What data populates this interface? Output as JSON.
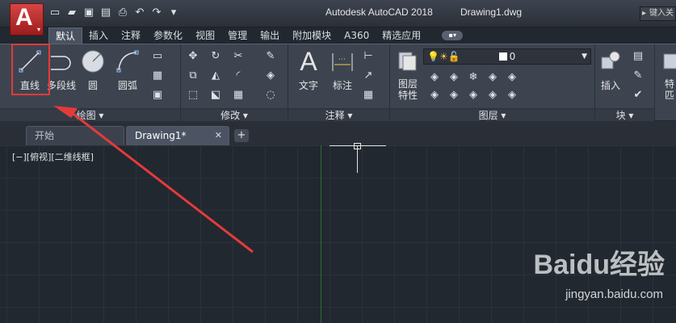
{
  "titlebar": {
    "logo_letter": "A",
    "app": "Autodesk AutoCAD 2018",
    "document": "Drawing1.dwg",
    "search_placeholder": "键入关"
  },
  "ribbon_tabs": [
    "默认",
    "插入",
    "注释",
    "参数化",
    "视图",
    "管理",
    "输出",
    "附加模块",
    "A360",
    "精选应用"
  ],
  "draw_panel": {
    "tools": [
      "直线",
      "多段线",
      "圆",
      "圆弧"
    ],
    "footer": "绘图"
  },
  "modify_panel": {
    "footer": "修改"
  },
  "annotation_panel": {
    "tools": [
      "文字",
      "标注"
    ],
    "footer": "注释"
  },
  "layers_panel": {
    "tool": "图层\n特性",
    "tool_line1": "图层",
    "tool_line2": "特性",
    "current_layer": "0",
    "footer": "图层"
  },
  "block_panel": {
    "tool": "插入",
    "footer": "块"
  },
  "properties_panel": {
    "tool_line1": "特",
    "tool_line2": "匹"
  },
  "file_tabs": {
    "start": "开始",
    "drawing": "Drawing1*"
  },
  "canvas": {
    "viewport_label": "[−][俯视][二维线框]"
  },
  "watermark": {
    "brand": "Baidu经验",
    "site": "jingyan.baidu.com"
  },
  "colors": {
    "highlight_box": "#e53a3a",
    "arrow": "#e53a3a",
    "canvas": "#212830"
  }
}
